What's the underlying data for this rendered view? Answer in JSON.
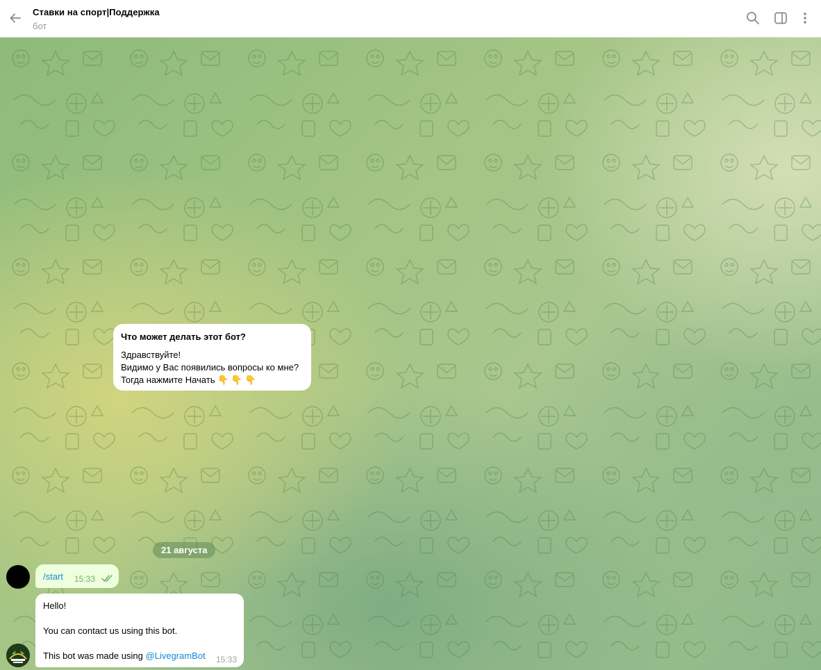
{
  "header": {
    "title": "Ставки на спорт|Поддержка",
    "subtitle": "бот",
    "icons": [
      "back-arrow-icon",
      "search-icon",
      "side-panel-icon",
      "more-vertical-icon"
    ]
  },
  "info_card": {
    "title": "Что может делать этот бот?",
    "lines": [
      "Здравствуйте!",
      "Видимо у Вас появились вопросы ко мне?",
      "Тогда нажмите Начать 👇 👇 👇"
    ]
  },
  "date_divider": "21 августа",
  "messages": [
    {
      "direction": "out",
      "text": "/start",
      "time": "15:33",
      "status": "read"
    },
    {
      "direction": "in",
      "lines": [
        "Hello!",
        "You can contact us using this bot.",
        "This bot was made using "
      ],
      "link": "@LivegramBot",
      "time": "15:33"
    }
  ],
  "colors": {
    "header_bg": "#ffffff",
    "bubble_out": "#eeffde",
    "bubble_in": "#ffffff",
    "link": "#168acd",
    "check": "#6fb16c"
  }
}
